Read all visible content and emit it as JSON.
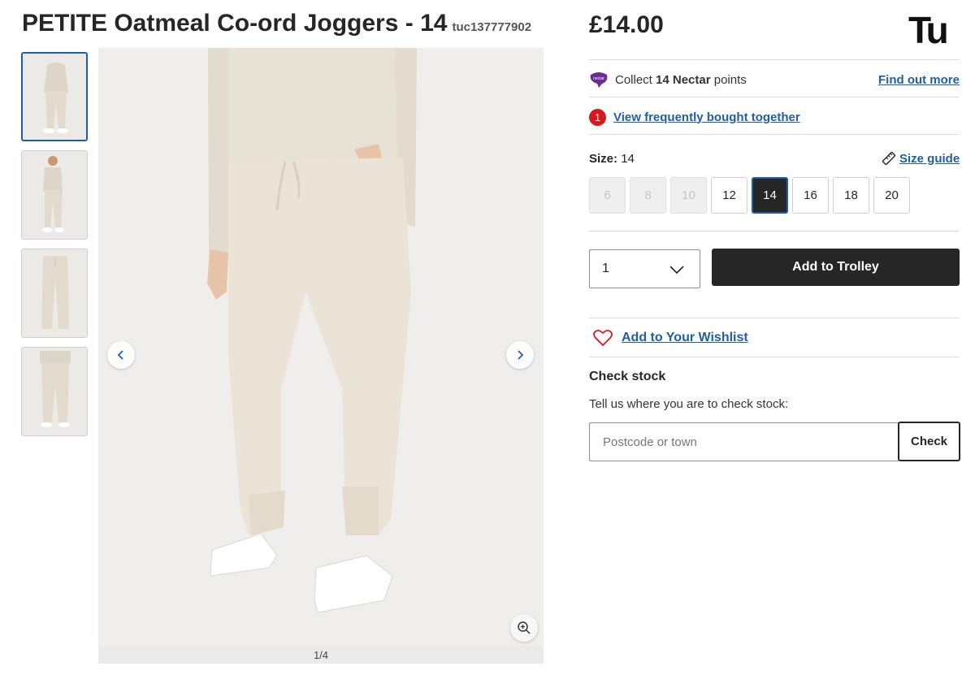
{
  "product": {
    "title": "PETITE Oatmeal Co-ord Joggers - 14",
    "sku": "tuc137777902",
    "price": "£14.00"
  },
  "brand": {
    "logo_text": "Tu"
  },
  "gallery": {
    "counter": "1/4",
    "thumbnail_count": 4,
    "active_thumbnail": 1,
    "prev_icon": "chevron-left-icon",
    "next_icon": "chevron-right-icon",
    "zoom_icon": "zoom-in-icon"
  },
  "nectar": {
    "prefix": "Collect",
    "points": "14 Nectar",
    "suffix": "points",
    "link": "Find out more"
  },
  "frequently_bought": {
    "badge": "1",
    "link": "View frequently bought together"
  },
  "size": {
    "label": "Size:",
    "selected": "14",
    "guide_link": "Size guide",
    "options": [
      {
        "value": "6",
        "state": "disabled"
      },
      {
        "value": "8",
        "state": "disabled"
      },
      {
        "value": "10",
        "state": "disabled"
      },
      {
        "value": "12",
        "state": "available"
      },
      {
        "value": "14",
        "state": "selected"
      },
      {
        "value": "16",
        "state": "available"
      },
      {
        "value": "18",
        "state": "available"
      },
      {
        "value": "20",
        "state": "available"
      }
    ]
  },
  "purchase": {
    "quantity": "1",
    "add_button": "Add to Trolley"
  },
  "wishlist": {
    "link": "Add to Your Wishlist"
  },
  "stock": {
    "title": "Check stock",
    "description": "Tell us where you are to check stock:",
    "placeholder": "Postcode or town",
    "button": "Check"
  },
  "colors": {
    "accent": "#1f5fa8",
    "primary_button": "#262626",
    "badge": "#d6191e",
    "nectar": "#6a2c91"
  }
}
